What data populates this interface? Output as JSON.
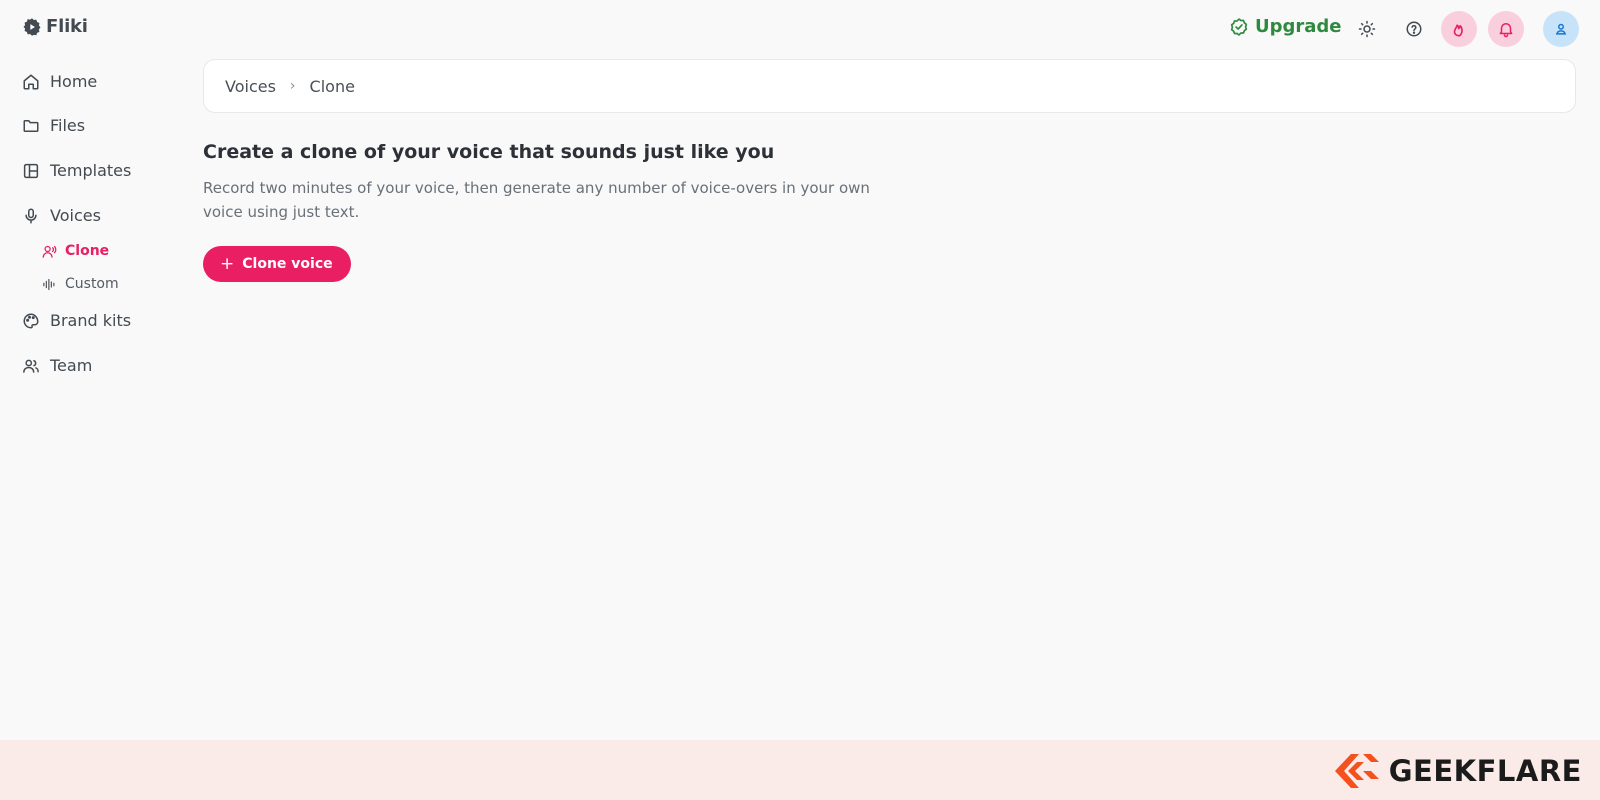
{
  "app": {
    "name": "Fliki"
  },
  "colors": {
    "accent": "#e91e63",
    "upgrade": "#2f8a3f",
    "footer_bg": "#fbebe8",
    "brand_orange": "#f4511e"
  },
  "sidebar": {
    "items": [
      {
        "label": "Home",
        "icon": "home-icon"
      },
      {
        "label": "Files",
        "icon": "folder-icon"
      },
      {
        "label": "Templates",
        "icon": "templates-icon"
      },
      {
        "label": "Voices",
        "icon": "microphone-icon"
      },
      {
        "label": "Brand kits",
        "icon": "palette-icon"
      },
      {
        "label": "Team",
        "icon": "team-icon"
      }
    ],
    "voice_subitems": [
      {
        "label": "Clone",
        "icon": "voice-clone-icon",
        "active": true
      },
      {
        "label": "Custom",
        "icon": "waveform-icon",
        "active": false
      }
    ]
  },
  "topbar": {
    "upgrade_label": "Upgrade",
    "icons": [
      "theme-toggle-icon",
      "help-icon",
      "streak-flame-icon",
      "notifications-bell-icon",
      "user-avatar-icon"
    ]
  },
  "breadcrumb": {
    "items": [
      "Voices",
      "Clone"
    ]
  },
  "main": {
    "heading": "Create a clone of your voice that sounds just like you",
    "description": "Record two minutes of your voice, then generate any number of voice-overs in your own voice using just text.",
    "cta_label": "Clone voice",
    "cta_icon": "plus-icon"
  },
  "watermark": {
    "brand": "GEEKFLARE"
  }
}
